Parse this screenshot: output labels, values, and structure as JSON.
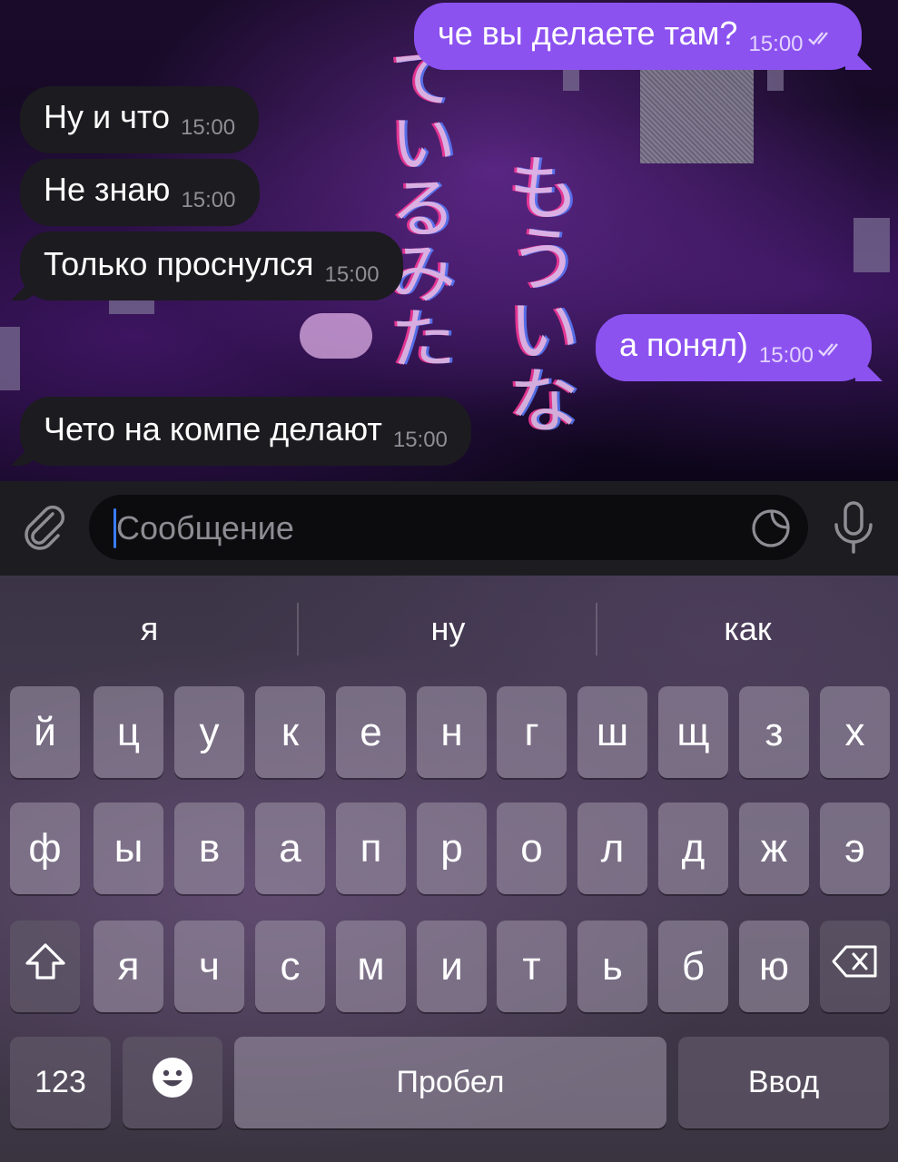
{
  "wallpaper": {
    "glyphs_left": "ているみた",
    "glyphs_right": "もういな"
  },
  "messages": [
    {
      "dir": "out",
      "text": "че вы делаете там?",
      "time": "15:00",
      "status": "read-double-check-icon"
    },
    {
      "dir": "in",
      "text": "Ну и что",
      "time": "15:00"
    },
    {
      "dir": "in",
      "text": "Не знаю",
      "time": "15:00"
    },
    {
      "dir": "in",
      "text": "Только проснулся",
      "time": "15:00"
    },
    {
      "dir": "out",
      "text": "а понял)",
      "time": "15:00",
      "status": "read-double-check-icon"
    },
    {
      "dir": "in",
      "text": "Чето на компе делают",
      "time": "15:00"
    }
  ],
  "composer": {
    "placeholder": "Сообщение",
    "value": "",
    "icons": [
      "paperclip-icon",
      "sticker-icon",
      "microphone-icon"
    ]
  },
  "keyboard": {
    "suggestions": [
      "я",
      "ну",
      "как"
    ],
    "row1": [
      "й",
      "ц",
      "у",
      "к",
      "е",
      "н",
      "г",
      "ш",
      "щ",
      "з",
      "х"
    ],
    "row2": [
      "ф",
      "ы",
      "в",
      "а",
      "п",
      "р",
      "о",
      "л",
      "д",
      "ж",
      "э"
    ],
    "row3": [
      "я",
      "ч",
      "с",
      "м",
      "и",
      "т",
      "ь",
      "б",
      "ю"
    ],
    "shift_icon": "shift-icon",
    "backspace_icon": "backspace-icon",
    "numbers_label": "123",
    "emoji_icon": "emoji-icon",
    "space_label": "Пробел",
    "return_label": "Ввод"
  },
  "colors": {
    "outgoing_bubble": "#8c52f0",
    "incoming_bubble": "#1c1b1f",
    "cursor": "#3a7cff"
  }
}
